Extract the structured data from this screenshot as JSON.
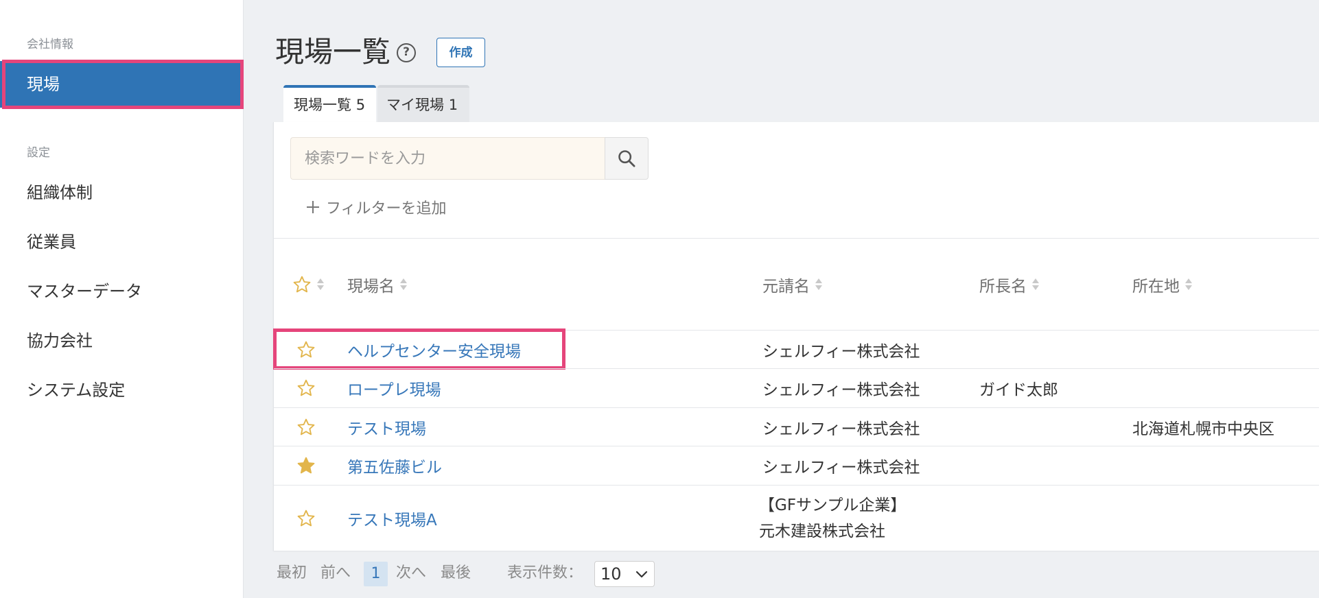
{
  "sidebar": {
    "sections": [
      {
        "label": "会社情報",
        "items": [
          {
            "label": "現場",
            "active": true
          }
        ]
      },
      {
        "label": "設定",
        "items": [
          {
            "label": "組織体制"
          },
          {
            "label": "従業員"
          },
          {
            "label": "マスターデータ"
          },
          {
            "label": "協力会社"
          },
          {
            "label": "システム設定"
          }
        ]
      }
    ]
  },
  "header": {
    "title": "現場一覧",
    "help_icon": "question-circle-icon",
    "help_glyph": "?",
    "create_label": "作成"
  },
  "tabs": [
    {
      "label": "現場一覧",
      "count": "5",
      "active": true
    },
    {
      "label": "マイ現場",
      "count": "1",
      "active": false
    }
  ],
  "search": {
    "placeholder": "検索ワードを入力",
    "value": "",
    "icon": "search-icon",
    "add_filter_icon": "plus-icon",
    "add_filter_label": "フィルターを追加"
  },
  "table": {
    "header": {
      "favorite_icon": "star-outline-icon",
      "sort_icon": "sort-icon",
      "columns": [
        "現場名",
        "元請名",
        "所長名",
        "所在地"
      ]
    },
    "rows": [
      {
        "icon": "star-outline-icon",
        "favorite": false,
        "name": "ヘルプセンター安全現場",
        "contractor": "シェルフィー株式会社",
        "manager": "",
        "location": ""
      },
      {
        "icon": "star-outline-icon",
        "favorite": false,
        "name": "ロープレ現場",
        "contractor": "シェルフィー株式会社",
        "manager": "ガイド太郎",
        "location": ""
      },
      {
        "icon": "star-outline-icon",
        "favorite": false,
        "name": "テスト現場",
        "contractor": "シェルフィー株式会社",
        "manager": "",
        "location": "北海道札幌市中央区"
      },
      {
        "icon": "star-filled-icon",
        "favorite": true,
        "name": "第五佐藤ビル",
        "contractor": "シェルフィー株式会社",
        "manager": "",
        "location": ""
      },
      {
        "icon": "star-outline-icon",
        "favorite": false,
        "name": "テスト現場A",
        "contractor": "【GFサンプル企業】\n元木建設株式会社",
        "manager": "",
        "location": ""
      }
    ]
  },
  "pagination": {
    "first": "最初",
    "prev": "前へ",
    "current": "1",
    "next": "次へ",
    "last": "最後",
    "per_page_label": "表示件数：",
    "per_page_value": "10",
    "per_page_icon": "chevron-down-icon"
  },
  "colors": {
    "accent": "#2f74b5",
    "link": "#3777b9",
    "highlight": "#e5457b",
    "star": "#e2b54b",
    "main_bg": "#eef0f3"
  }
}
